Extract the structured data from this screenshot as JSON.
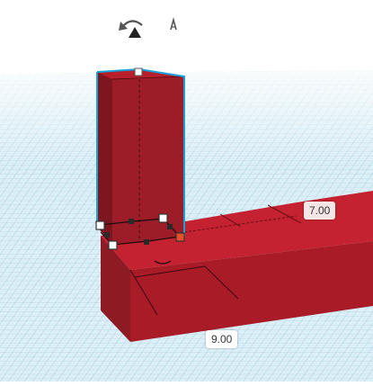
{
  "viewport": {
    "toolbar": {
      "rotate_icon": "rotate-arrow-icon",
      "drop_icon": "drop-to-workplane-icon"
    },
    "dimensions": {
      "length_label": "7.00",
      "width_label": "9.00"
    },
    "colors": {
      "grid_bg": "#ddeef5",
      "grid_line": "#8fc6db",
      "shape_red": "#c4202c",
      "shape_dark": "#8b1822",
      "selection": "#19a2d8",
      "handle_orange": "#e8502a"
    }
  }
}
